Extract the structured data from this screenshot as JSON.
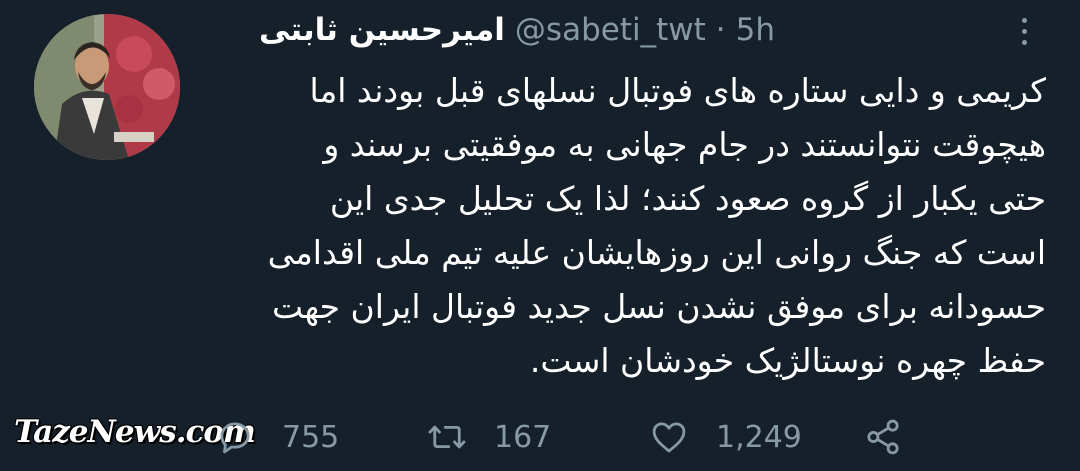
{
  "header": {
    "display_name": "امیرحسین ثابتی",
    "handle": "@sabeti_twt",
    "separator": "·",
    "time": "5h"
  },
  "body": {
    "lines": [
      "کریمی و دایی ستاره های فوتبال نسلهای قبل بودند اما",
      "هیچوقت نتوانستند در جام جهانی به موفقیتی برسند و",
      "حتی یکبار از گروه صعود کنند؛ لذا یک تحلیل جدی این",
      "است که جنگ روانی این روزهایشان علیه تیم ملی اقدامی",
      "حسودانه برای موفق نشدن نسل جدید فوتبال ایران جهت",
      "حفظ چهره نوستالژیک خودشان است."
    ]
  },
  "actions": {
    "reply_count": "755",
    "retweet_count": "167",
    "like_count": "1,249"
  },
  "watermark": "TazeNews.com",
  "colors": {
    "background": "#15202b",
    "text": "#ffffff",
    "secondary": "#8899a6"
  },
  "icons": [
    "more-icon",
    "reply-icon",
    "retweet-icon",
    "like-icon",
    "share-icon"
  ]
}
